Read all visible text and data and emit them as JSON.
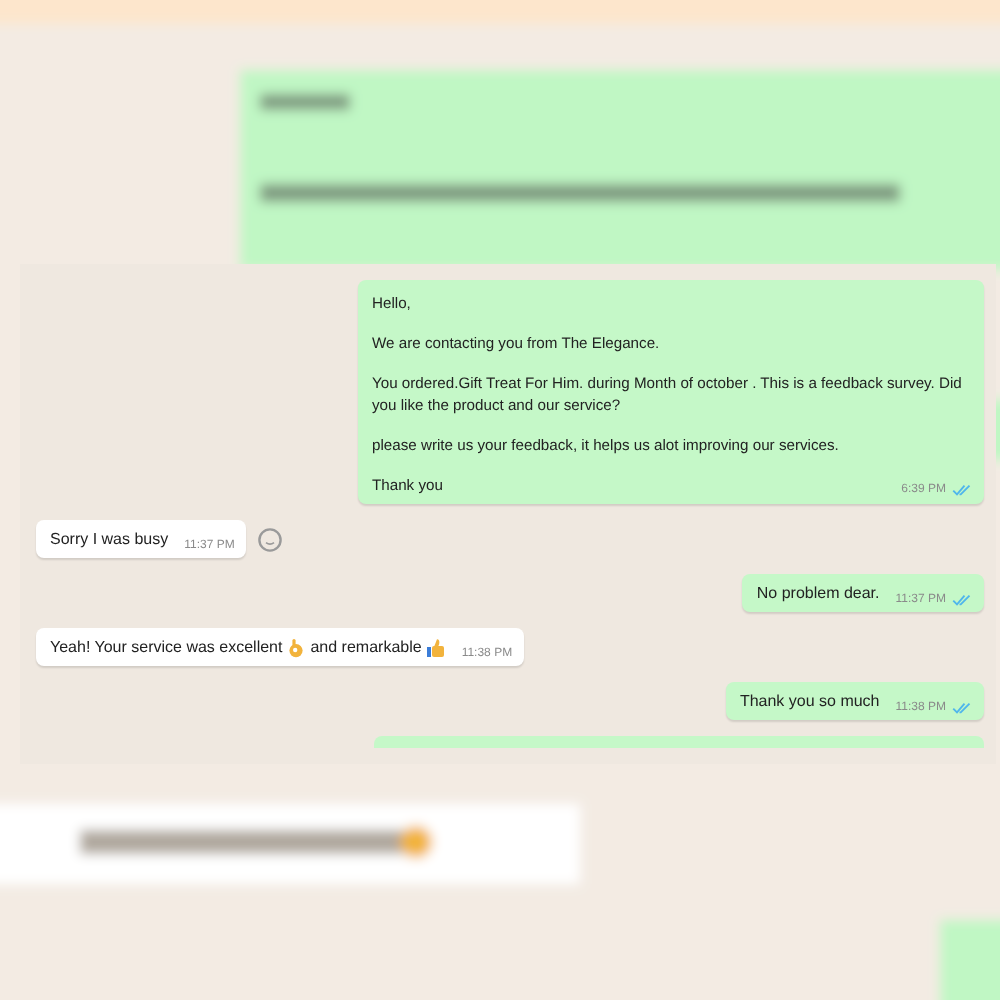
{
  "messages": [
    {
      "kind": "outgoing",
      "paragraphs": [
        "Hello,",
        "We are contacting you from The Elegance.",
        "You ordered.Gift Treat For Him. during Month of october . This is a feedback survey. Did you like the product and our service?",
        "please write us your feedback, it helps us alot improving our services.",
        "Thank you"
      ],
      "time": "6:39 PM",
      "read": true
    },
    {
      "kind": "incoming",
      "parts": [
        {
          "kind": "text",
          "text": "Sorry I was busy"
        }
      ],
      "time": "11:37 PM",
      "reaction_button": true
    },
    {
      "kind": "outgoing",
      "parts": [
        {
          "kind": "text",
          "text": "No problem dear."
        }
      ],
      "time": "11:37 PM",
      "read": true
    },
    {
      "kind": "incoming",
      "parts": [
        {
          "kind": "text",
          "text": "Yeah! Your service was excellent"
        },
        {
          "kind": "ok-hand"
        },
        {
          "kind": "text",
          "text": "and remarkable"
        },
        {
          "kind": "thumbs-up"
        }
      ],
      "time": "11:38 PM"
    },
    {
      "kind": "outgoing",
      "parts": [
        {
          "kind": "text",
          "text": "Thank you so much"
        }
      ],
      "time": "11:38 PM",
      "read": true
    }
  ]
}
